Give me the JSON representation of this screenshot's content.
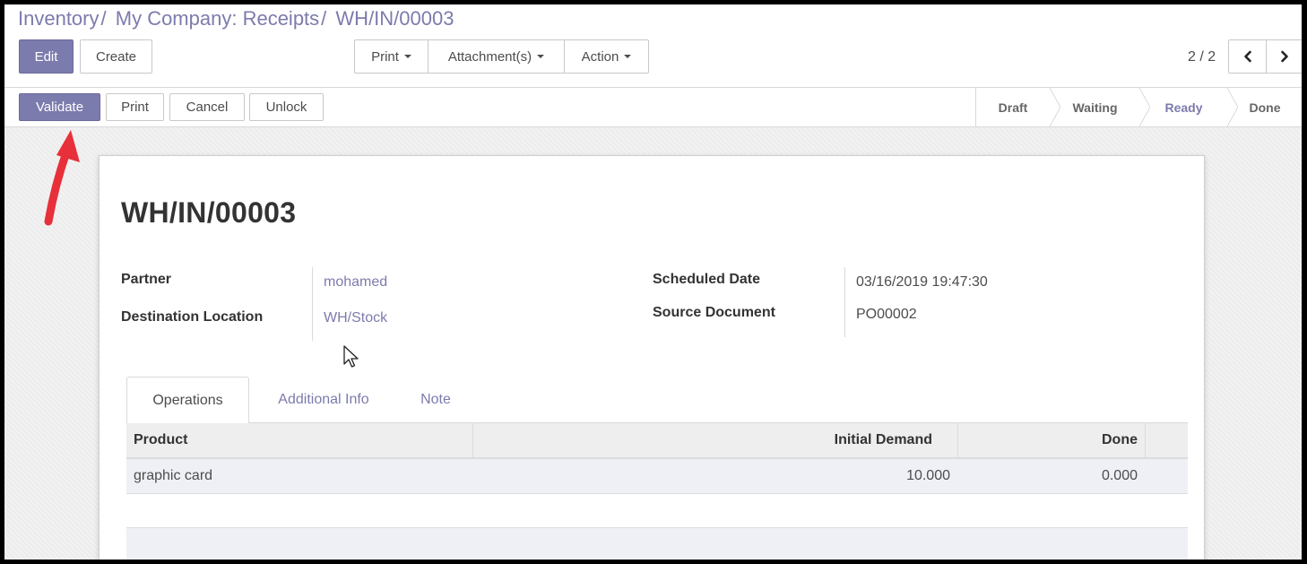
{
  "breadcrumb": {
    "items": [
      "Inventory",
      "My Company: Receipts"
    ],
    "separator": "/",
    "current": "WH/IN/00003"
  },
  "toolbar": {
    "edit_label": "Edit",
    "create_label": "Create",
    "print_menu_label": "Print",
    "attachments_menu_label": "Attachment(s)",
    "action_menu_label": "Action"
  },
  "pager": {
    "value": "2 / 2",
    "prev_icon": "chevron-left-icon",
    "next_icon": "chevron-right-icon"
  },
  "statusbar": {
    "buttons": {
      "validate": "Validate",
      "print": "Print",
      "cancel": "Cancel",
      "unlock": "Unlock"
    },
    "steps": [
      {
        "label": "Draft"
      },
      {
        "label": "Waiting"
      },
      {
        "label": "Ready",
        "current": true
      },
      {
        "label": "Done"
      }
    ]
  },
  "record": {
    "title": "WH/IN/00003",
    "fields": {
      "partner_label": "Partner",
      "partner_value": "mohamed",
      "destination_label": "Destination Location",
      "destination_value": "WH/Stock",
      "scheduled_label": "Scheduled Date",
      "scheduled_value": "03/16/2019 19:47:30",
      "source_label": "Source Document",
      "source_value": "PO00002"
    }
  },
  "tabs": [
    {
      "label": "Operations",
      "active": true
    },
    {
      "label": "Additional Info"
    },
    {
      "label": "Note"
    }
  ],
  "table": {
    "headers": {
      "product": "Product",
      "demand": "Initial Demand",
      "done": "Done"
    },
    "rows": [
      {
        "product": "graphic card",
        "demand": "10.000",
        "done": "0.000"
      }
    ]
  },
  "colors": {
    "accent": "#7c7bad",
    "annotation_arrow": "#e8303a"
  }
}
